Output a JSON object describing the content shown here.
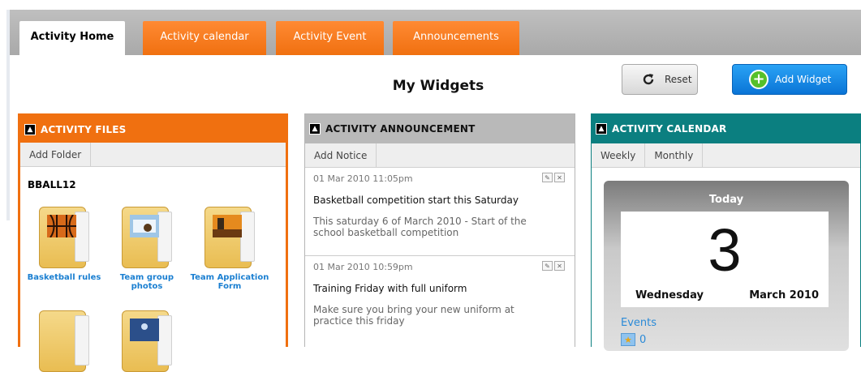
{
  "tabs": [
    {
      "label": "Activity Home",
      "active": true
    },
    {
      "label": "Activity calendar",
      "active": false
    },
    {
      "label": "Activity Event",
      "active": false
    },
    {
      "label": "Announcements",
      "active": false
    }
  ],
  "page": {
    "title": "My Widgets"
  },
  "toolbar": {
    "reset_label": "Reset",
    "add_widget_label": "Add Widget",
    "reset_icon": "refresh-icon",
    "add_icon": "plus-icon"
  },
  "files_widget": {
    "title": "ACTIVITY FILES",
    "add_folder_label": "Add Folder",
    "folder_name": "BBALL12",
    "files": [
      {
        "label": "Basketball rules",
        "thumb": "basketball"
      },
      {
        "label": "Team group photos",
        "thumb": "photo"
      },
      {
        "label": "Team Application Form",
        "thumb": "sunset"
      }
    ]
  },
  "announcement_widget": {
    "title": "ACTIVITY ANNOUNCEMENT",
    "add_notice_label": "Add Notice",
    "notices": [
      {
        "date": "01 Mar 2010 11:05pm",
        "heading": "Basketball competition start this Saturday",
        "body": "This saturday 6 of March 2010 - Start of the school basketball competition"
      },
      {
        "date": "01 Mar 2010 10:59pm",
        "heading": "Training Friday with full uniform",
        "body": "Make sure you bring your new uniform at practice this friday"
      }
    ]
  },
  "calendar_widget": {
    "title": "ACTIVITY CALENDAR",
    "weekly_label": "Weekly",
    "monthly_label": "Monthly",
    "today_label": "Today",
    "day_number": "3",
    "weekday": "Wednesday",
    "month_year": "March 2010",
    "events_label": "Events",
    "event_count": "0"
  },
  "colors": {
    "orange": "#f07010",
    "teal": "#0b7f80",
    "gray": "#b9b9b9",
    "blue": "#0a74d6"
  }
}
